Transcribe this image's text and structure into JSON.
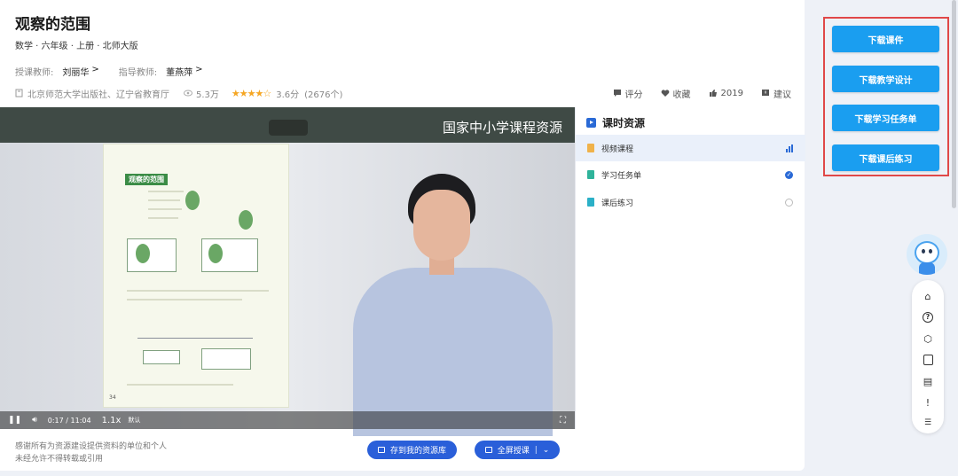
{
  "course": {
    "title": "观察的范围",
    "subtitle": "数学 · 六年级 · 上册 · 北师大版",
    "teacher_label": "授课教师:",
    "teacher_name": "刘丽华",
    "advisor_label": "指导教师:",
    "advisor_name": "董燕萍",
    "chevron": ">"
  },
  "meta": {
    "publisher": "北京师范大学出版社、辽宁省教育厅",
    "views": "5.3万",
    "rating": 3.6,
    "stars_glyphs": "★★★★☆",
    "score": "3.6分",
    "rating_count": "(2676个)",
    "actions": {
      "rate": "评分",
      "favorite": "收藏",
      "likes": "2019",
      "suggest": "建议"
    }
  },
  "video": {
    "watermark": "国家中小学课程资源",
    "time": "0:17 / 11:04",
    "speed": "1.1x",
    "quality": "默认",
    "book_header": "观察的范围",
    "book_page": "34",
    "progress_fraction": 0.026
  },
  "resources": {
    "heading": "课时资源",
    "items": [
      {
        "label": "视频课程",
        "state": "playing",
        "color": "#f0b24a"
      },
      {
        "label": "学习任务单",
        "state": "done",
        "color": "#2fb39a"
      },
      {
        "label": "课后练习",
        "state": "todo",
        "color": "#2bb0c7"
      }
    ]
  },
  "footer": {
    "note_line1": "感谢所有为资源建设提供资料的单位和个人",
    "note_line2": "未经允许不得转载或引用",
    "save_button": "存到我的资源库",
    "fullscreen_button": "全屏授课",
    "fullscreen_sep": "|",
    "fullscreen_chevron": "⌄"
  },
  "downloads": {
    "courseware": "下载课件",
    "lesson_design": "下载教学设计",
    "task_sheet": "下载学习任务单",
    "exercise": "下载课后练习",
    "highlight_color": "#e04848",
    "button_color": "#1a9ef0"
  },
  "tools": [
    "home-icon",
    "help-icon",
    "box-icon",
    "copy-icon",
    "document-icon",
    "feedback-icon",
    "more-icon"
  ]
}
